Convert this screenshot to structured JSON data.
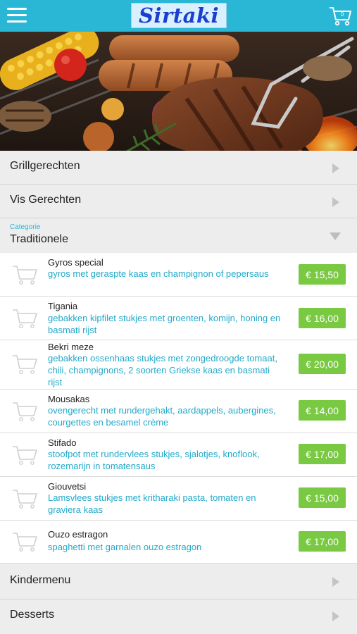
{
  "header": {
    "logo_text": "Sirtaki",
    "cart_count": "0"
  },
  "sections_before": [
    {
      "label": "Grillgerechten"
    },
    {
      "label": "Vis Gerechten"
    }
  ],
  "category": {
    "caption": "Categorie",
    "label": "Traditionele"
  },
  "items": [
    {
      "name": "Gyros special",
      "desc": "gyros met geraspte kaas en champignon of pepersaus",
      "price": "€ 15,50"
    },
    {
      "name": "Tigania",
      "desc": "gebakken kipfilet stukjes met groenten, komijn, honing en basmati rijst",
      "price": "€ 16,00"
    },
    {
      "name": "Bekri meze",
      "desc": "gebakken ossenhaas stukjes met zongedroogde tomaat, chili, champignons, 2 soorten Griekse kaas en basmati rijst",
      "price": "€ 20,00"
    },
    {
      "name": "Mousakas",
      "desc": "ovengerecht met rundergehakt, aardappels, aubergines, courgettes en besamel crème",
      "price": "€ 14,00"
    },
    {
      "name": "Stifado",
      "desc": "stoofpot met rundervlees stukjes, sjalotjes, knoflook, rozemarijn in tomatensaus",
      "price": "€ 17,00"
    },
    {
      "name": "Giouvetsi",
      "desc": "Lamsvlees stukjes met kritharaki pasta, tomaten en graviera kaas",
      "price": "€ 15,00"
    },
    {
      "name": "Ouzo estragon",
      "desc": "spaghetti met garnalen ouzo estragon",
      "price": "€ 17,00"
    }
  ],
  "sections_after": [
    {
      "label": "Kindermenu"
    },
    {
      "label": "Desserts"
    }
  ],
  "colors": {
    "header": "#2ab7d6",
    "description": "#22a9c9",
    "price": "#7ac943"
  },
  "icons": [
    "menu-icon",
    "cart-icon"
  ]
}
